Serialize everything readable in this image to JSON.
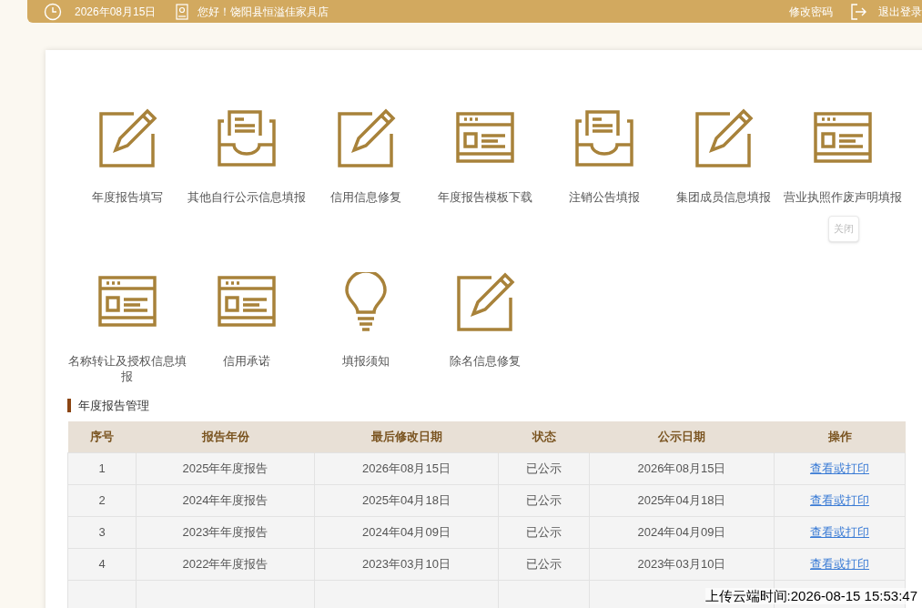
{
  "top_bar": {
    "date": "2026年08月15日",
    "greeting": "您好！饶阳县恒溢佳家具店",
    "change_password": "修改密码",
    "logout": "退出登录"
  },
  "tools": [
    {
      "kind": "edit",
      "label": "年度报告填写"
    },
    {
      "kind": "tray",
      "label": "其他自行公示信息填报"
    },
    {
      "kind": "edit",
      "label": "信用信息修复"
    },
    {
      "kind": "form",
      "label": "年度报告模板下载"
    },
    {
      "kind": "tray",
      "label": "注销公告填报"
    },
    {
      "kind": "edit",
      "label": "集团成员信息填报"
    },
    {
      "kind": "form",
      "label": "营业执照作废声明填报",
      "tooltip": "关闭"
    },
    {
      "kind": "form",
      "label": "名称转让及授权信息填报"
    },
    {
      "kind": "form",
      "label": "信用承诺"
    },
    {
      "kind": "bulb",
      "label": "填报须知"
    },
    {
      "kind": "edit",
      "label": "除名信息修复"
    }
  ],
  "section_title": "年度报告管理",
  "table": {
    "columns": [
      "序号",
      "报告年份",
      "最后修改日期",
      "状态",
      "公示日期",
      "操作"
    ],
    "rows": [
      [
        "1",
        "2025年年度报告",
        "2026年08月15日",
        "已公示",
        "2026年08月15日",
        "查看或打印"
      ],
      [
        "2",
        "2024年年度报告",
        "2025年04月18日",
        "已公示",
        "2025年04月18日",
        "查看或打印"
      ],
      [
        "3",
        "2023年年度报告",
        "2024年04月09日",
        "已公示",
        "2024年04月09日",
        "查看或打印"
      ],
      [
        "4",
        "2022年年度报告",
        "2023年03月10日",
        "已公示",
        "2023年03月10日",
        "查看或打印"
      ]
    ]
  },
  "upload_stamp": "上传云端时间:2026-08-15 15:53:47"
}
